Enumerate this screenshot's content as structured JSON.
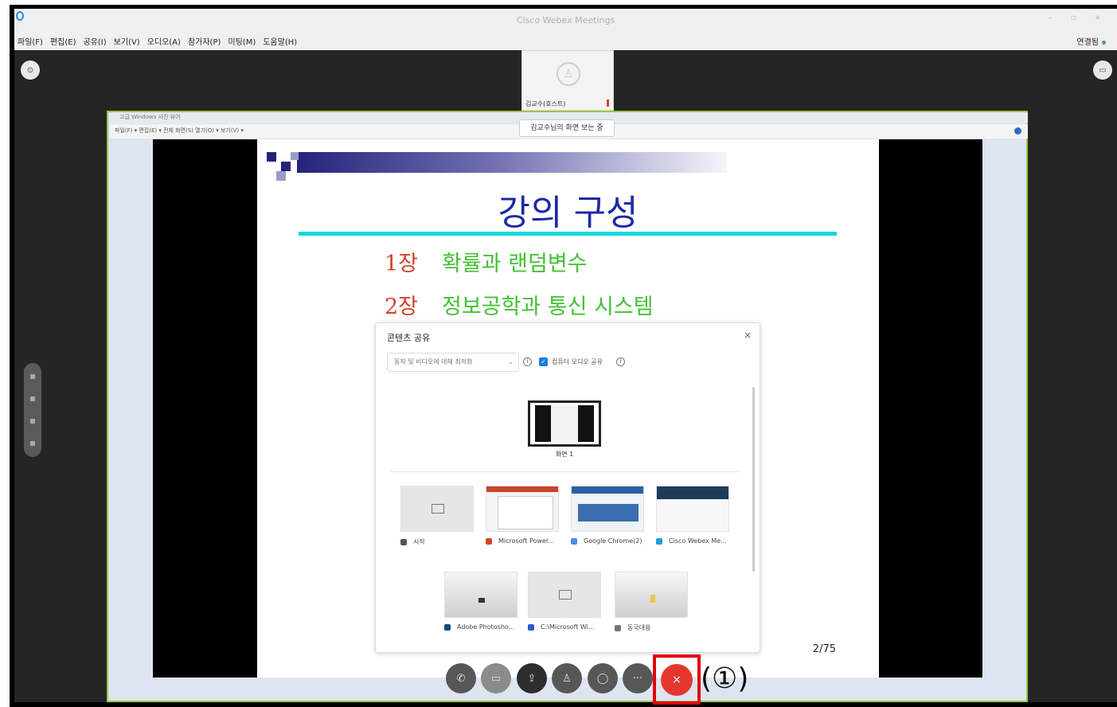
{
  "window": {
    "title": "Cisco Webex Meetings",
    "controls": "–  ▫  ×"
  },
  "menu": {
    "items": [
      "파일(F)",
      "편집(E)",
      "공유(I)",
      "보기(V)",
      "오디오(A)",
      "참가자(P)",
      "미팅(M)",
      "도움말(H)"
    ],
    "connection": "연결됨"
  },
  "participant": {
    "name": "김교수(호스트)"
  },
  "viewing_label": "김교수님의 화면 보는 중",
  "shared_window": {
    "title": "고급 Windows 사진 뷰어",
    "menu": "파일(F) ▾  편집(E) ▾  전체 화면(S)  열기(O) ▾  보기(V) ▾"
  },
  "slide": {
    "heading": "강의 구성",
    "items": [
      {
        "num": "1장",
        "text": "확률과 랜덤변수"
      },
      {
        "num": "2장",
        "text": "정보공학과 통신 시스템"
      }
    ],
    "page": "2/75"
  },
  "share_dialog": {
    "title": "콘텐츠 공유",
    "close": "×",
    "select_value": "동작 및 비디오에 대해 최적화",
    "checkbox_label": "컴퓨터 오디오 공유",
    "info": "i",
    "screen_label": "화면 1",
    "apps_row1": [
      {
        "label": "시작",
        "color": "#555555"
      },
      {
        "label": "Microsoft Power...",
        "color": "#d24726"
      },
      {
        "label": "Google Chrome(2)",
        "color": "#4a8af4"
      },
      {
        "label": "Cisco Webex Me...",
        "color": "#1ba0d7"
      }
    ],
    "apps_row2": [
      {
        "label": "Adobe Photosho...",
        "color": "#0a4a7a"
      },
      {
        "label": "C:\\Microsoft Wi...",
        "color": "#2a5bd0"
      },
      {
        "label": "동국대용",
        "color": "#777777"
      }
    ]
  },
  "toolbar": {
    "buttons": [
      {
        "name": "audio-button",
        "icon": "✆"
      },
      {
        "name": "video-button",
        "icon": "▭"
      },
      {
        "name": "share-button",
        "icon": "⇪"
      },
      {
        "name": "participants-button",
        "icon": "♙"
      },
      {
        "name": "chat-button",
        "icon": "◯"
      },
      {
        "name": "more-button",
        "icon": "···"
      }
    ],
    "end_icon": "×",
    "callout": "(①)"
  },
  "colors": {
    "end_button": "#e4382f",
    "highlight_box": "#e3000f",
    "slide_heading": "#1d2aa6",
    "slide_item_number": "#d0442a",
    "slide_item_text": "#42c232",
    "slide_rule": "#12d8de"
  }
}
